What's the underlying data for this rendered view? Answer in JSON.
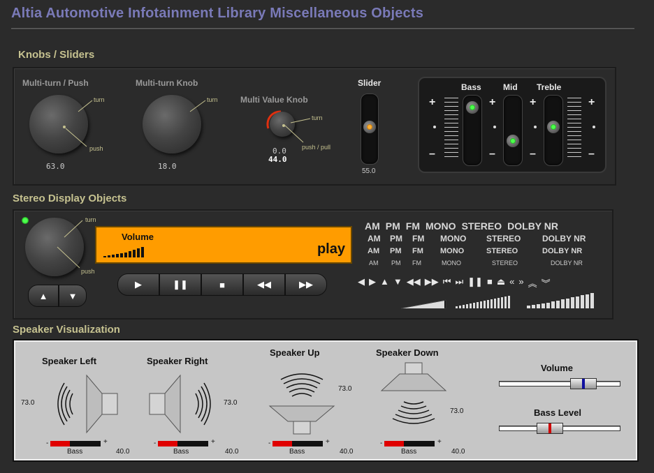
{
  "title": "Altia Automotive Infotainment Library Miscellaneous Objects",
  "sections": {
    "knobs": "Knobs / Sliders",
    "stereo": "Stereo Display Objects",
    "speaker": "Speaker Visualization"
  },
  "knobs": {
    "k1": {
      "label": "Multi-turn / Push",
      "turn": "turn",
      "push": "push",
      "value": "63.0"
    },
    "k2": {
      "label": "Multi-turn Knob",
      "turn": "turn",
      "value": "18.0"
    },
    "k3": {
      "label": "Multi Value Knob",
      "turn": "turn",
      "push": "push / pull",
      "value1": "0.0",
      "value2": "44.0"
    },
    "slider": {
      "label": "Slider",
      "value": "55.0",
      "level": 0.55
    },
    "eq": {
      "bass": "Bass",
      "mid": "Mid",
      "treble": "Treble",
      "plus": "+",
      "minus": "–",
      "bass_level": 0.8,
      "mid_level": 0.3,
      "treble_level": 0.55
    }
  },
  "stereo": {
    "knob": {
      "turn": "turn",
      "push": "push"
    },
    "display": {
      "label": "Volume",
      "status": "play",
      "color": "#ff9c00"
    },
    "bands": [
      "AM",
      "PM",
      "FM",
      "MONO",
      "STEREO",
      "DOLBY NR"
    ],
    "arrow_up": "▲",
    "arrow_down": "▼",
    "transport": [
      "▶",
      "❚❚",
      "■",
      "◀◀",
      "▶▶"
    ],
    "icons": [
      "◀",
      "▶",
      "▲",
      "▼",
      "◀◀",
      "▶▶",
      "⏮",
      "⏭",
      "❚❚",
      "■",
      "⏏",
      "«",
      "»",
      "︽",
      "︾"
    ]
  },
  "speakers": {
    "left": {
      "label": "Speaker Left",
      "value": "73.0",
      "bass": "Bass",
      "bass_value": "40.0"
    },
    "right": {
      "label": "Speaker Right",
      "value": "73.0",
      "bass": "Bass",
      "bass_value": "40.0"
    },
    "up": {
      "label": "Speaker Up",
      "value": "73.0",
      "bass": "Bass",
      "bass_value": "40.0"
    },
    "down": {
      "label": "Speaker Down",
      "value": "73.0",
      "bass": "Bass",
      "bass_value": "40.0"
    },
    "minus": "-",
    "plus": "+",
    "volume": {
      "label": "Volume",
      "level": 0.6
    },
    "bass_level": {
      "label": "Bass Level",
      "level": 0.4
    }
  },
  "colors": {
    "accent": "#7a7ab8",
    "section": "#c6c290",
    "led_green": "#4dff4d",
    "led_orange": "#ffb030",
    "bass_red": "#e00000"
  }
}
